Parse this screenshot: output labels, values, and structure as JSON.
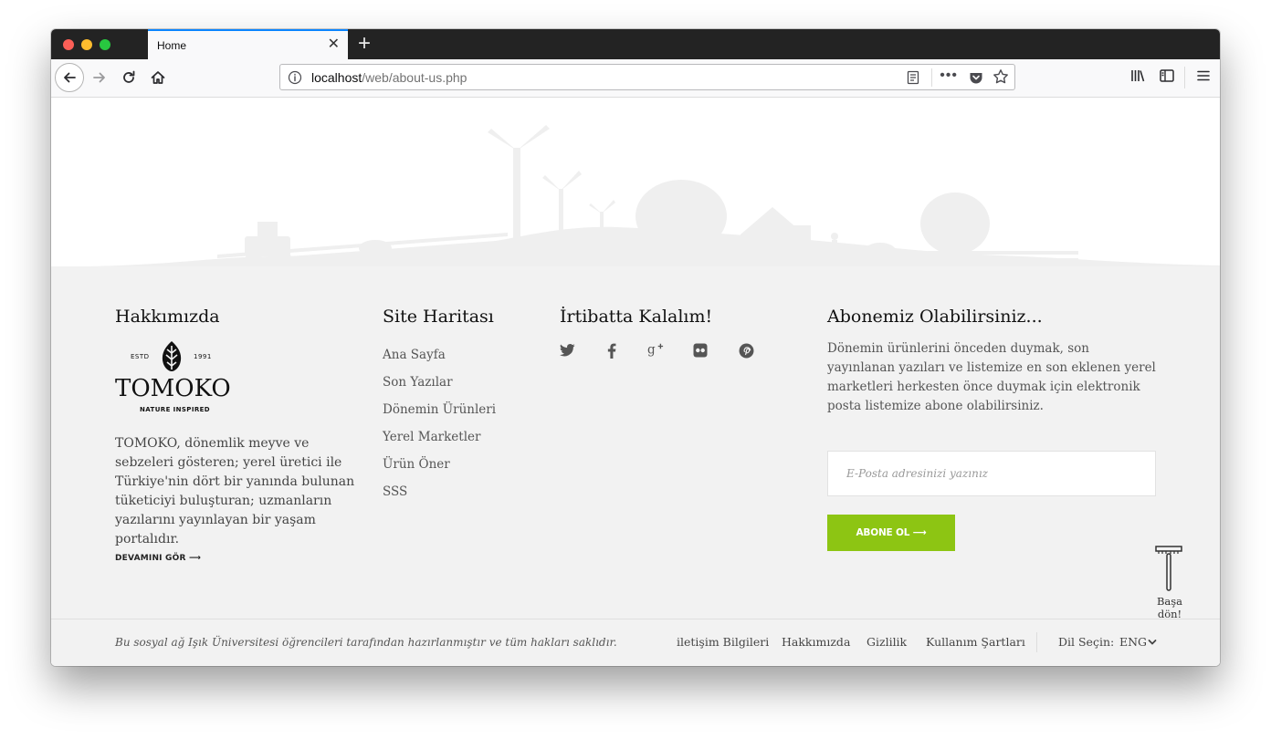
{
  "browser": {
    "tab_title": "Home",
    "tab_close": "✕",
    "new_tab": "+",
    "url_host": "localhost",
    "url_path": "/web/about-us.php",
    "url_more": "•••",
    "accent": "#0a84ff"
  },
  "footer": {
    "about": {
      "title": "Hakkımızda",
      "logo": {
        "estd": "ESTD",
        "year": "1991",
        "brand": "TOMOKO",
        "tagline": "NATURE INSPIRED"
      },
      "text": "TOMOKO, dönemlik meyve ve sebzeleri gösteren; yerel üretici ile Türkiye'nin dört bir yanında bulunan tüketiciyi buluşturan; uzmanların yazılarını yayınlayan bir yaşam portalıdır.",
      "more_link": "DEVAMINI GÖR ⟶"
    },
    "sitemap": {
      "title": "Site Haritası",
      "items": [
        "Ana Sayfa",
        "Son Yazılar",
        "Dönemin Ürünleri",
        "Yerel Marketler",
        "Ürün Öner",
        "SSS"
      ]
    },
    "contact": {
      "title": "İrtibatta Kalalım!",
      "social_icons": [
        "twitter-icon",
        "facebook-icon",
        "google-plus-icon",
        "flickr-icon",
        "pinterest-icon"
      ]
    },
    "subscribe": {
      "title": "Abonemiz Olabilirsiniz...",
      "text": "Dönemin ürünlerini önceden duymak, son yayınlanan yazıları ve listemize en son eklenen yerel marketleri herkesten önce duymak için elektronik posta listemize abone olabilirsiniz.",
      "input_placeholder": "E-Posta adresinizi yazınız",
      "input_value": "",
      "button_label": "ABONE OL ⟶",
      "button_color": "#8dc513"
    },
    "back_to_top": "Başa dön!",
    "bottom": {
      "copyright": "Bu sosyal ağ Işık Üniversitesi öğrencileri tarafından hazırlanmıştır ve tüm hakları saklıdır.",
      "links": [
        "iletişim Bilgileri",
        "Hakkımızda",
        "Gizlilik",
        "Kullanım Şartları"
      ],
      "language_label": "Dil Seçin:",
      "language_value": "ENG"
    }
  }
}
